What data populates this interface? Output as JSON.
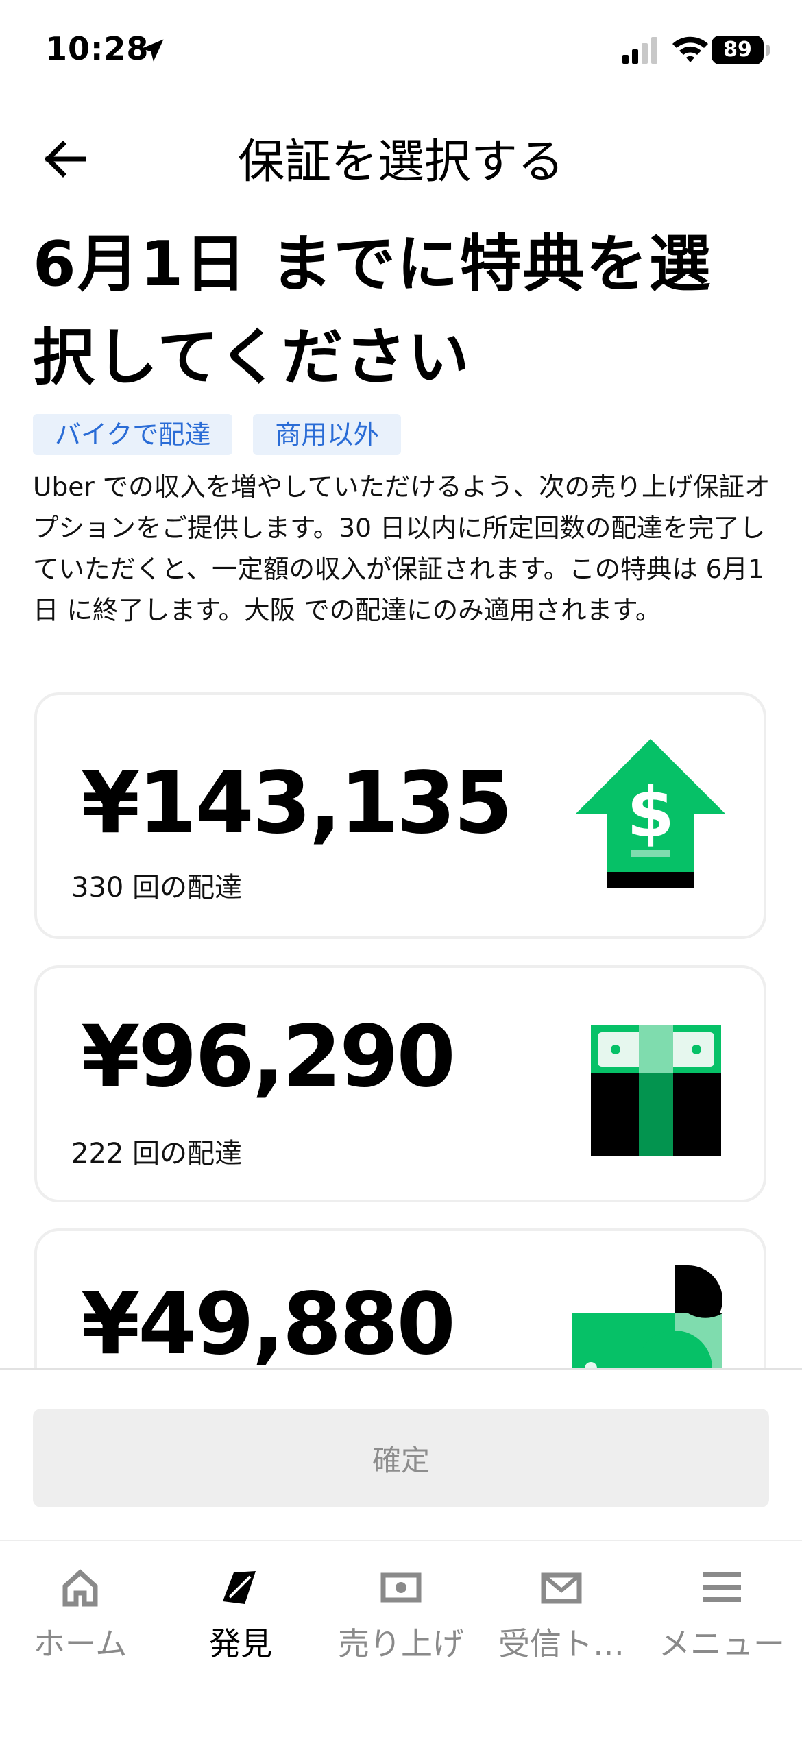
{
  "status_bar": {
    "time": "10:28",
    "battery": "89"
  },
  "header": {
    "title": "保証を選択する"
  },
  "headline": "6月1日 までに特典を選択してください",
  "tags": [
    "バイクで配達",
    "商用以外"
  ],
  "description": "Uber での収入を増やしていただけるよう、次の売り上げ保証オプションをご提供します。30 日以内に所定回数の配達を完了していただくと、一定額の収入が保証されます。この特典は 6月1日 に終了します。大阪 での配達にのみ適用されます。",
  "options": [
    {
      "amount": "¥143,135",
      "deliveries": "330 回の配達",
      "icon": "money-up-arrow-icon"
    },
    {
      "amount": "¥96,290",
      "deliveries": "222 回の配達",
      "icon": "cash-gift-icon"
    },
    {
      "amount": "¥49,880",
      "deliveries": "",
      "icon": "cash-bill-icon"
    }
  ],
  "confirm_label": "確定",
  "tabs": [
    {
      "label": "ホーム",
      "icon": "home-icon",
      "active": false
    },
    {
      "label": "発見",
      "icon": "discover-icon",
      "active": true
    },
    {
      "label": "売り上げ",
      "icon": "earnings-icon",
      "active": false
    },
    {
      "label": "受信ト…",
      "icon": "inbox-icon",
      "active": false
    },
    {
      "label": "メニュー",
      "icon": "menu-icon",
      "active": false
    }
  ],
  "colors": {
    "accent_green": "#06c167",
    "tag_blue": "#2a6cd6",
    "tag_bg": "#e9f1fb"
  }
}
